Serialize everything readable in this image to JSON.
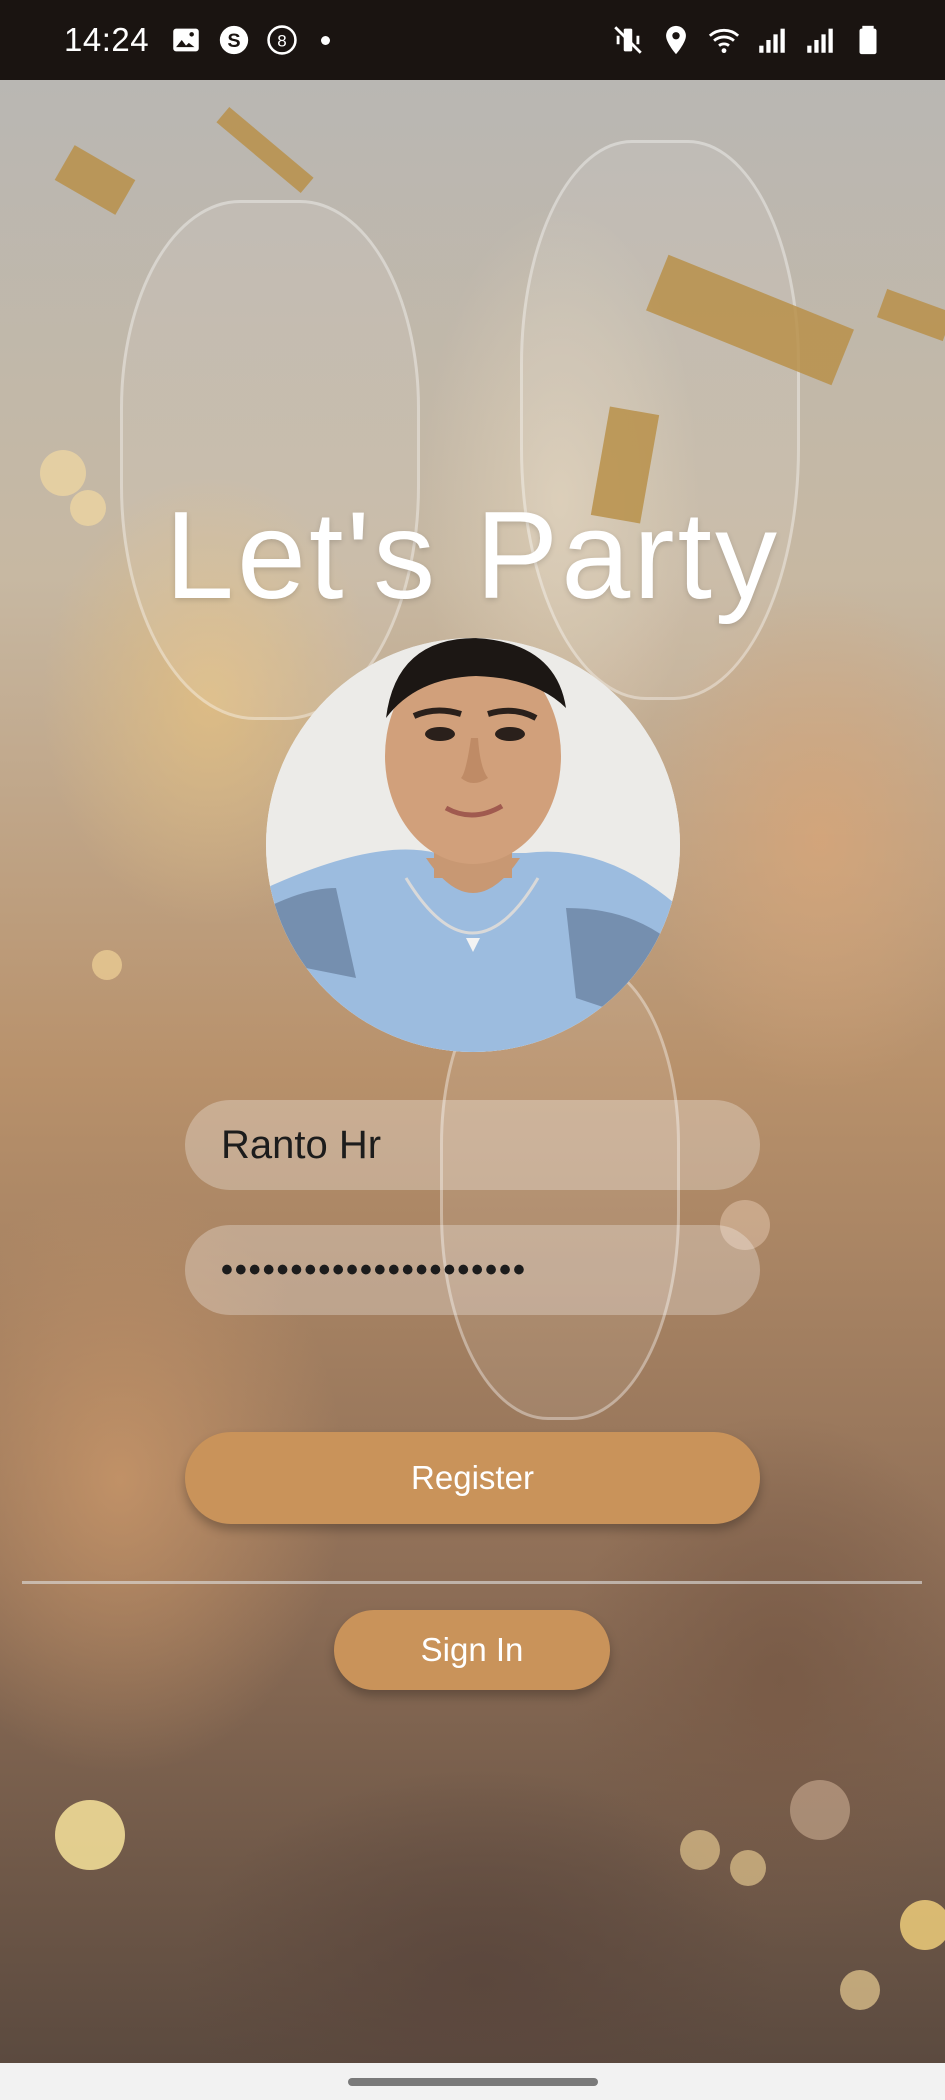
{
  "status_bar": {
    "time": "14:24",
    "left_icons": [
      "image-icon",
      "skype-icon",
      "eight-icon",
      "notification-dot"
    ],
    "right_icons": [
      "mute-icon",
      "location-icon",
      "wifi-icon",
      "signal-icon",
      "signal-icon-2",
      "battery-icon"
    ]
  },
  "app": {
    "title": "Let's Party",
    "accent_color": "#c9935a"
  },
  "form": {
    "username_value": "Ranto Hr",
    "password_value": "••••••••••••••••••••••",
    "register_label": "Register",
    "signin_label": "Sign In"
  }
}
